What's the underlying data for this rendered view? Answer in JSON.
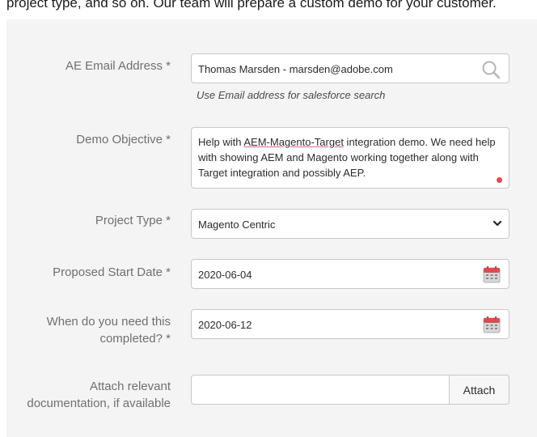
{
  "top_text": "project type, and so on. Our team will prepare a custom demo for your customer.",
  "ae_email": {
    "label": "AE Email Address *",
    "value": "Thomas Marsden - marsden@adobe.com",
    "help": "Use Email address for salesforce search",
    "icon": "search-icon"
  },
  "demo_objective": {
    "label": "Demo Objective *",
    "before": "Help with ",
    "misspelled": "AEM-Magento-Target",
    "after": " integration demo. We need help with showing AEM and Magento working together along with Target integration and possibly AEP."
  },
  "project_type": {
    "label": "Project Type *",
    "selected": "Magento Centric",
    "icon": "chevron-down-icon"
  },
  "start_date": {
    "label": "Proposed Start Date *",
    "value": "2020-06-04",
    "icon": "calendar-icon"
  },
  "completion_date": {
    "label_line1": "When do you need this",
    "label_line2": "completed? *",
    "value": "2020-06-12",
    "icon": "calendar-icon"
  },
  "attachment": {
    "label_line1": "Attach relevant",
    "label_line2": "documentation, if available",
    "button": "Attach"
  },
  "colors": {
    "panel_bg": "#f4f4f4",
    "label": "#707070",
    "calendar_red": "#e34850",
    "spell_underline": "#e0609a"
  }
}
